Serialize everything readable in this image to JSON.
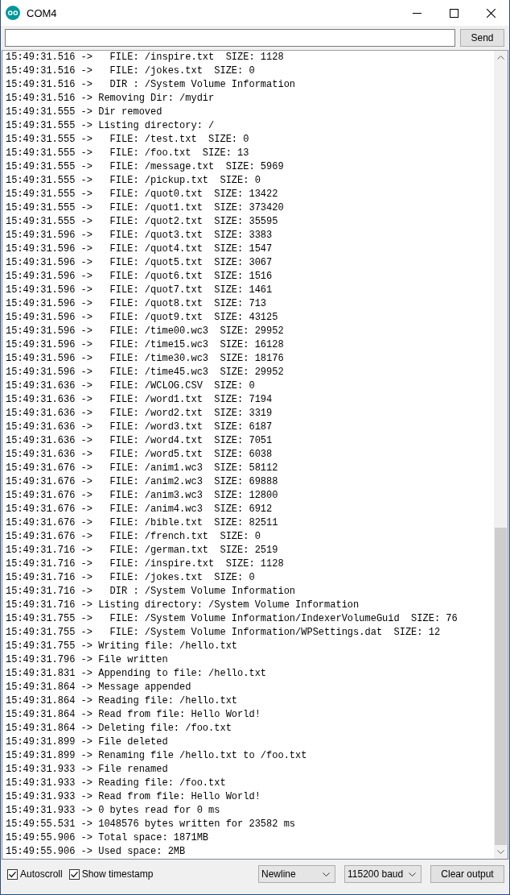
{
  "window": {
    "title": "COM4"
  },
  "send_bar": {
    "button": "Send"
  },
  "log_lines": [
    "15:49:31.516 ->   FILE: /inspire.txt  SIZE: 1128",
    "15:49:31.516 ->   FILE: /jokes.txt  SIZE: 0",
    "15:49:31.516 ->   DIR : /System Volume Information",
    "15:49:31.516 -> Removing Dir: /mydir",
    "15:49:31.555 -> Dir removed",
    "15:49:31.555 -> Listing directory: /",
    "15:49:31.555 ->   FILE: /test.txt  SIZE: 0",
    "15:49:31.555 ->   FILE: /foo.txt  SIZE: 13",
    "15:49:31.555 ->   FILE: /message.txt  SIZE: 5969",
    "15:49:31.555 ->   FILE: /pickup.txt  SIZE: 0",
    "15:49:31.555 ->   FILE: /quot0.txt  SIZE: 13422",
    "15:49:31.555 ->   FILE: /quot1.txt  SIZE: 373420",
    "15:49:31.555 ->   FILE: /quot2.txt  SIZE: 35595",
    "15:49:31.596 ->   FILE: /quot3.txt  SIZE: 3383",
    "15:49:31.596 ->   FILE: /quot4.txt  SIZE: 1547",
    "15:49:31.596 ->   FILE: /quot5.txt  SIZE: 3067",
    "15:49:31.596 ->   FILE: /quot6.txt  SIZE: 1516",
    "15:49:31.596 ->   FILE: /quot7.txt  SIZE: 1461",
    "15:49:31.596 ->   FILE: /quot8.txt  SIZE: 713",
    "15:49:31.596 ->   FILE: /quot9.txt  SIZE: 43125",
    "15:49:31.596 ->   FILE: /time00.wc3  SIZE: 29952",
    "15:49:31.596 ->   FILE: /time15.wc3  SIZE: 16128",
    "15:49:31.596 ->   FILE: /time30.wc3  SIZE: 18176",
    "15:49:31.596 ->   FILE: /time45.wc3  SIZE: 29952",
    "15:49:31.636 ->   FILE: /WCLOG.CSV  SIZE: 0",
    "15:49:31.636 ->   FILE: /word1.txt  SIZE: 7194",
    "15:49:31.636 ->   FILE: /word2.txt  SIZE: 3319",
    "15:49:31.636 ->   FILE: /word3.txt  SIZE: 6187",
    "15:49:31.636 ->   FILE: /word4.txt  SIZE: 7051",
    "15:49:31.636 ->   FILE: /word5.txt  SIZE: 6038",
    "15:49:31.676 ->   FILE: /anim1.wc3  SIZE: 58112",
    "15:49:31.676 ->   FILE: /anim2.wc3  SIZE: 69888",
    "15:49:31.676 ->   FILE: /anim3.wc3  SIZE: 12800",
    "15:49:31.676 ->   FILE: /anim4.wc3  SIZE: 6912",
    "15:49:31.676 ->   FILE: /bible.txt  SIZE: 82511",
    "15:49:31.676 ->   FILE: /french.txt  SIZE: 0",
    "15:49:31.716 ->   FILE: /german.txt  SIZE: 2519",
    "15:49:31.716 ->   FILE: /inspire.txt  SIZE: 1128",
    "15:49:31.716 ->   FILE: /jokes.txt  SIZE: 0",
    "15:49:31.716 ->   DIR : /System Volume Information",
    "15:49:31.716 -> Listing directory: /System Volume Information",
    "15:49:31.755 ->   FILE: /System Volume Information/IndexerVolumeGuid  SIZE: 76",
    "15:49:31.755 ->   FILE: /System Volume Information/WPSettings.dat  SIZE: 12",
    "15:49:31.755 -> Writing file: /hello.txt",
    "15:49:31.796 -> File written",
    "15:49:31.831 -> Appending to file: /hello.txt",
    "15:49:31.864 -> Message appended",
    "15:49:31.864 -> Reading file: /hello.txt",
    "15:49:31.864 -> Read from file: Hello World!",
    "15:49:31.864 -> Deleting file: /foo.txt",
    "15:49:31.899 -> File deleted",
    "15:49:31.899 -> Renaming file /hello.txt to /foo.txt",
    "15:49:31.933 -> File renamed",
    "15:49:31.933 -> Reading file: /foo.txt",
    "15:49:31.933 -> Read from file: Hello World!",
    "15:49:31.933 -> 0 bytes read for 0 ms",
    "15:49:55.531 -> 1048576 bytes written for 23582 ms",
    "15:49:55.906 -> Total space: 1871MB",
    "15:49:55.906 -> Used space: 2MB"
  ],
  "footer": {
    "checkboxes": [
      {
        "label": "Autoscroll",
        "checked": true
      },
      {
        "label": "Show timestamp",
        "checked": true
      }
    ],
    "dropdowns": [
      "Newline",
      "115200 baud"
    ],
    "clear_button": "Clear output"
  }
}
